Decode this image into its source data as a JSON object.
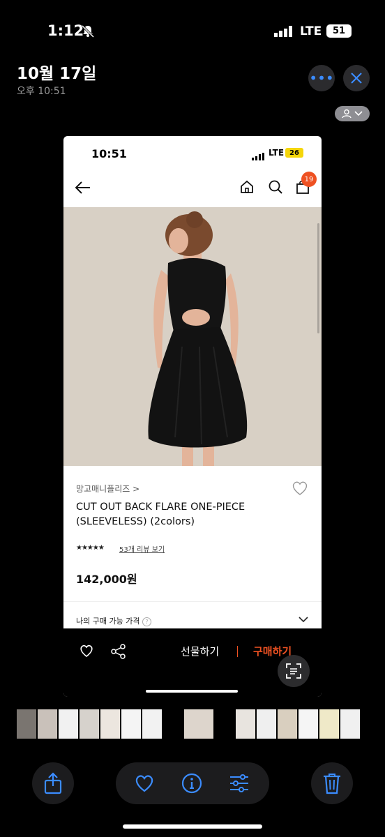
{
  "status_bar": {
    "time": "1:12",
    "carrier": "LTE",
    "battery": "51"
  },
  "photo": {
    "date": "10월 17일",
    "time": "오후 10:51"
  },
  "screenshot": {
    "status": {
      "time": "10:51",
      "network": "LTE",
      "battery": "26"
    },
    "cart_count": "19",
    "product": {
      "brand": "망고매니플리즈 >",
      "title": "CUT OUT BACK FLARE ONE-PIECE (SLEEVELESS) (2colors)",
      "rating_stars": "★★★★★",
      "reviews": "53개 리뷰 보기",
      "price": "142,000원",
      "my_price_label": "나의 구매 가능 가격"
    },
    "actions": {
      "gift": "선물하기",
      "buy": "구매하기"
    }
  },
  "colors": {
    "accent_blue": "#3b8cff",
    "brand_orange": "#ee5122"
  },
  "thumbnails": 16
}
